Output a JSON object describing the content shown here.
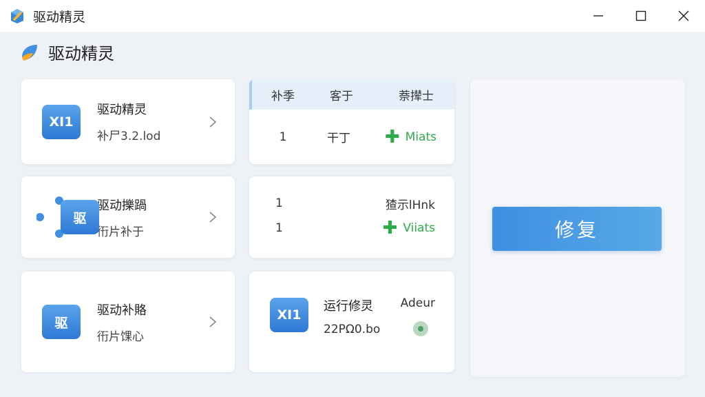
{
  "window": {
    "title": "驱动精灵",
    "app_icon": "app-logo-icon",
    "controls": [
      "minimize-icon",
      "maximize-icon",
      "close-icon"
    ]
  },
  "brand": {
    "title": "驱动精灵",
    "icon": "brand-logo-icon"
  },
  "left_cards": [
    {
      "icon_text": "XI1",
      "title": "驱动精灵",
      "subtitle": "补尸3.2.lod",
      "icon": "square-tile-icon"
    },
    {
      "icon_text": "驱",
      "title": "驱动擽踻",
      "subtitle": "衎片补于",
      "icon": "puzzle-tile-icon"
    },
    {
      "icon_text": "驱",
      "title": "驱动补賂",
      "subtitle": "衎片馃心",
      "icon": "square-tile-icon"
    }
  ],
  "table": {
    "headers": [
      "补季",
      "客于",
      "萘撵士"
    ],
    "rows": [
      {
        "c1": "1",
        "c2": "干丁",
        "c3": "Miats"
      }
    ]
  },
  "middle_list": {
    "rows": [
      {
        "n": "1",
        "value": "猹示lHnk",
        "has_plus": false
      },
      {
        "n": "1",
        "value": "Viiats",
        "has_plus": true
      }
    ]
  },
  "status_card": {
    "icon_text": "XI1",
    "title": "运行修灵",
    "subtitle": "22PΩ0.bo",
    "status": "Adeur"
  },
  "actions": {
    "repair_label": "修复"
  },
  "colors": {
    "accent": "#3f8fe2",
    "green": "#2eaa4a",
    "background": "#eef2f7"
  }
}
